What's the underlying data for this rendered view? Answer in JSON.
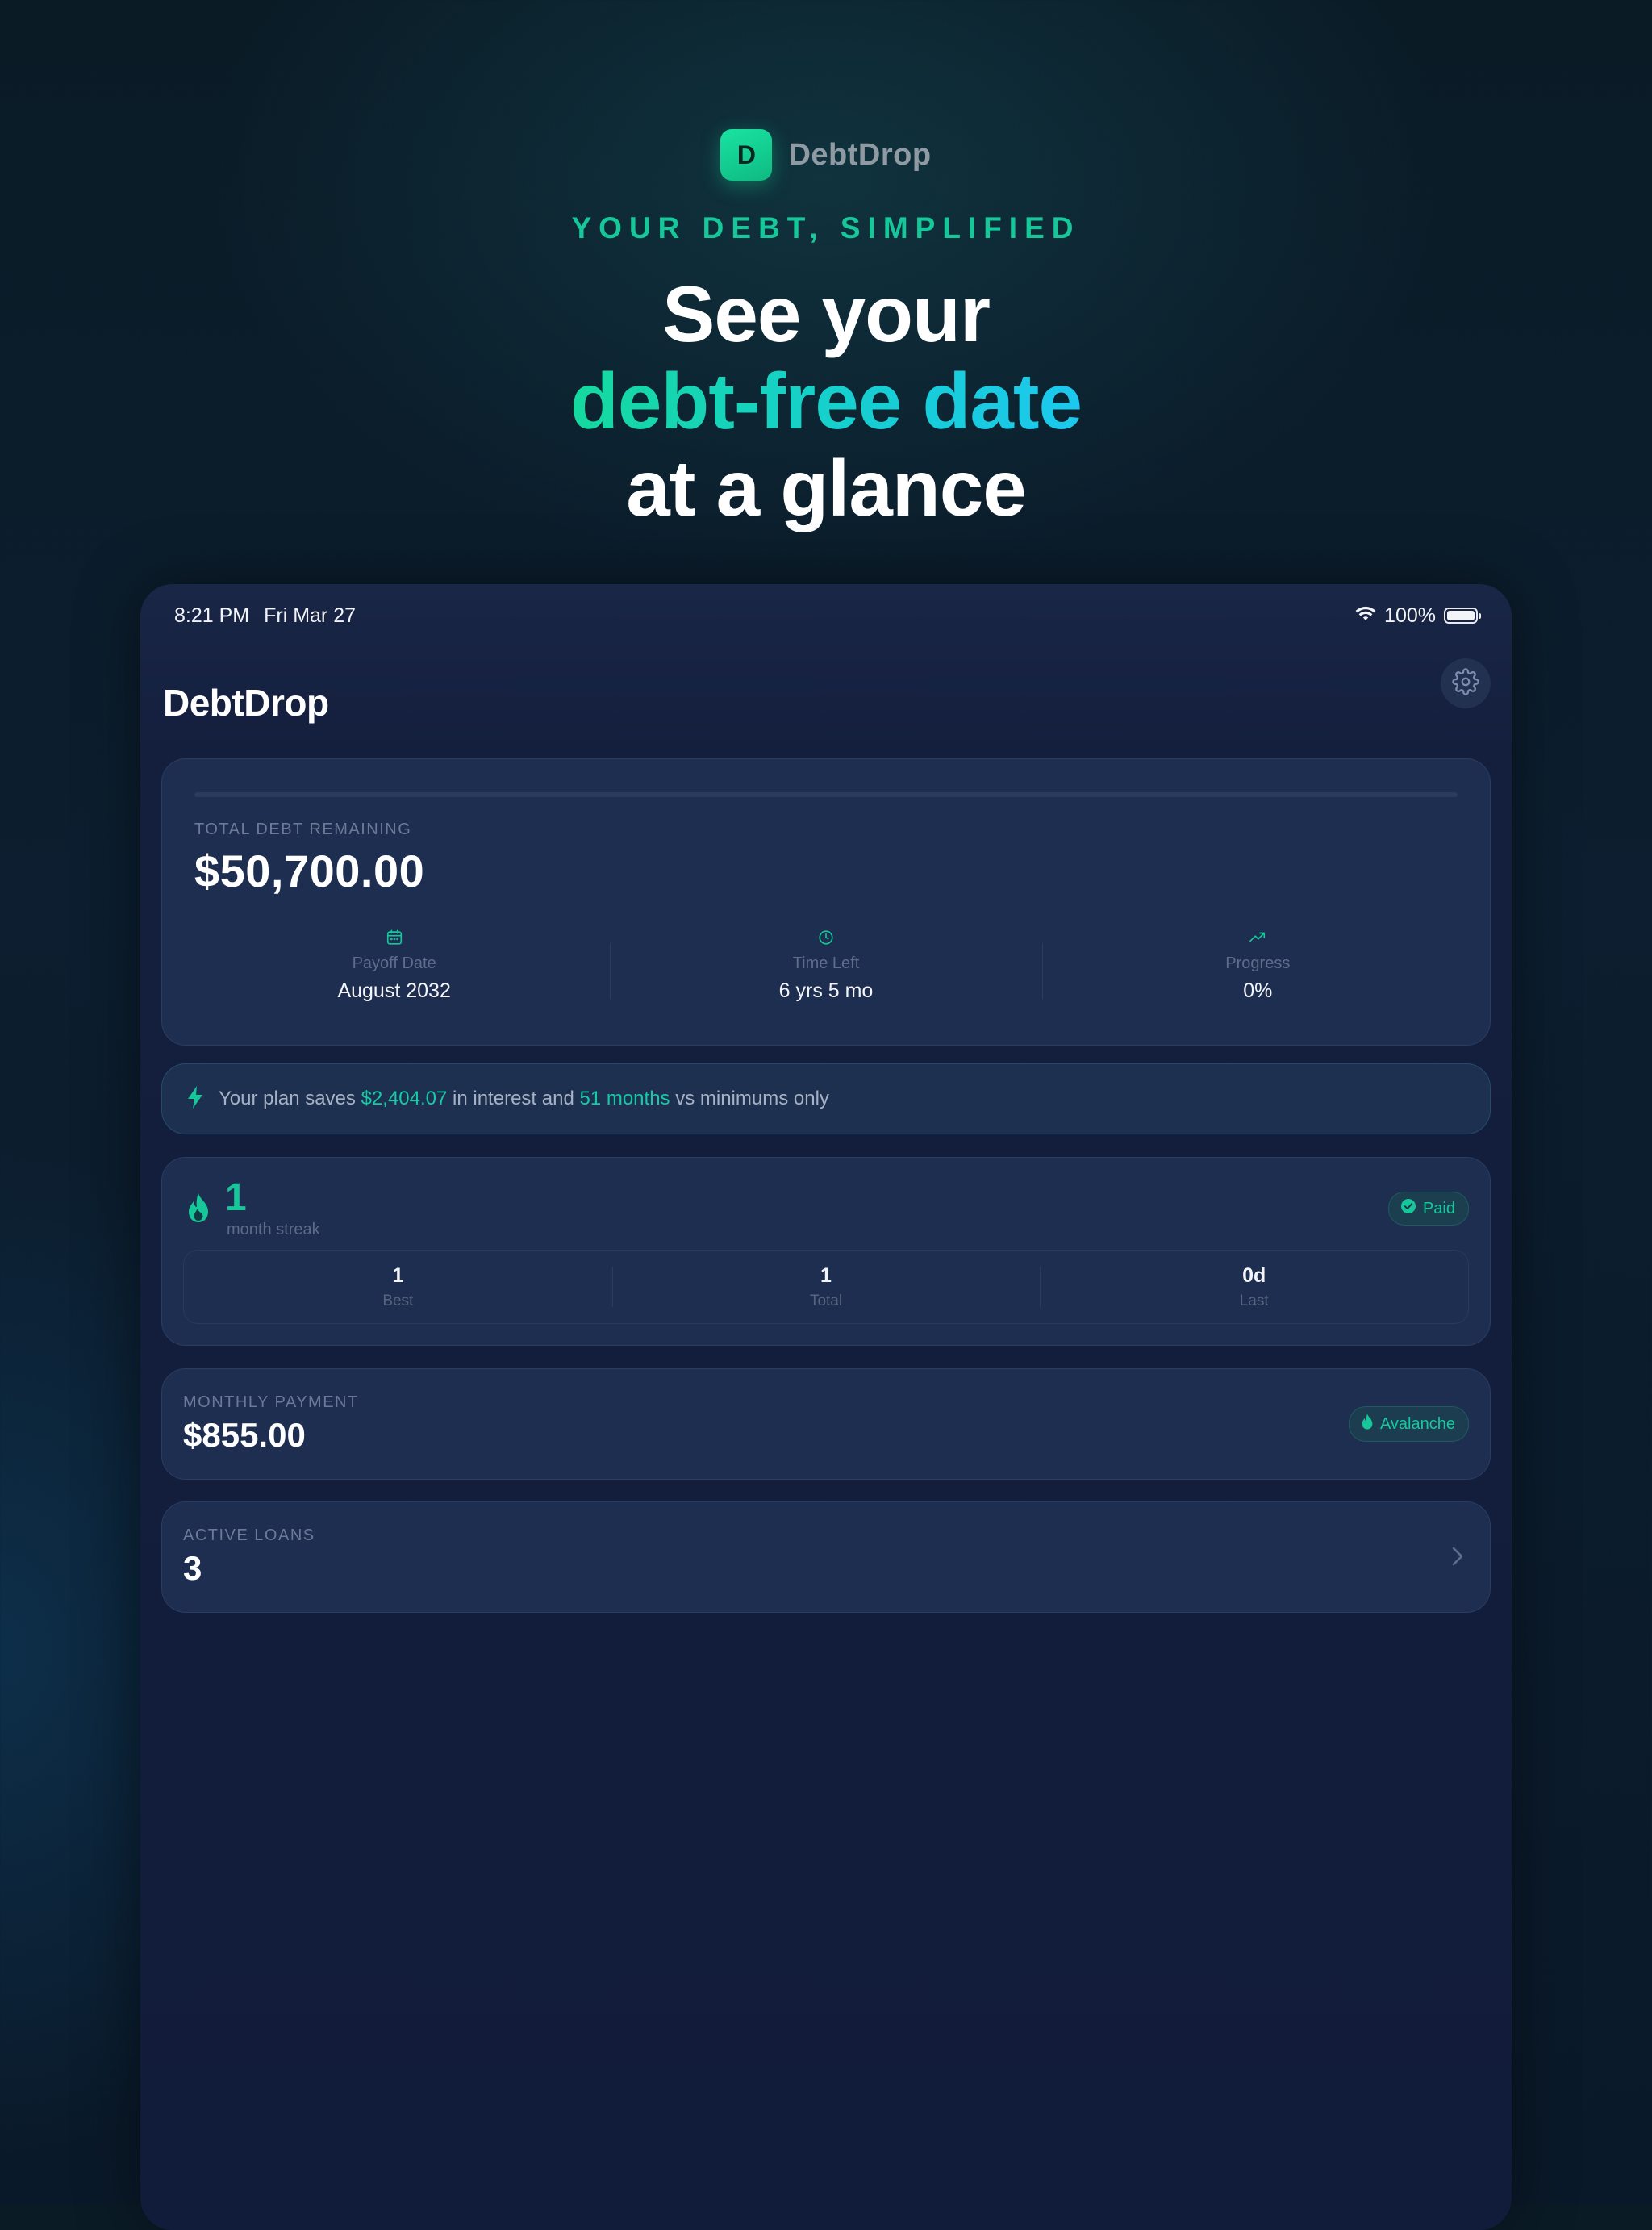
{
  "hero": {
    "brand_initial": "D",
    "brand_name": "DebtDrop",
    "tagline": "YOUR DEBT, SIMPLIFIED",
    "headline_line1": "See your",
    "headline_line2": "debt-free date",
    "headline_line3": "at a glance"
  },
  "status_bar": {
    "time": "8:21 PM",
    "date": "Fri Mar 27",
    "battery": "100%",
    "battery_level": 1.0
  },
  "app": {
    "title": "DebtDrop",
    "settings_icon": "gear-icon"
  },
  "summary": {
    "progress_fraction": 0.0,
    "label": "TOTAL DEBT REMAINING",
    "total": "$50,700.00",
    "stats": [
      {
        "icon": "calendar-icon",
        "label": "Payoff Date",
        "value": "August 2032"
      },
      {
        "icon": "clock-icon",
        "label": "Time Left",
        "value": "6 yrs 5 mo"
      },
      {
        "icon": "trending-up-icon",
        "label": "Progress",
        "value": "0%"
      }
    ]
  },
  "savings": {
    "icon": "lightning-icon",
    "prefix": "Your plan saves",
    "amount": "$2,404.07",
    "middle": "in interest and",
    "months": "51 months",
    "suffix": "vs minimums only"
  },
  "streak": {
    "icon": "flame-icon",
    "count": "1",
    "label": "month streak",
    "badge": "Paid",
    "stats": [
      {
        "value": "1",
        "label": "Best"
      },
      {
        "value": "1",
        "label": "Total"
      },
      {
        "value": "0d",
        "label": "Last"
      }
    ]
  },
  "monthly": {
    "label": "MONTHLY PAYMENT",
    "value": "$855.00",
    "strategy": "Avalanche"
  },
  "loans": {
    "label": "ACTIVE LOANS",
    "count": "3"
  },
  "colors": {
    "accent": "#16c79a",
    "accent_cyan": "#1cc8ee",
    "card": "#1e2e50",
    "background": "#0c1e2f"
  }
}
